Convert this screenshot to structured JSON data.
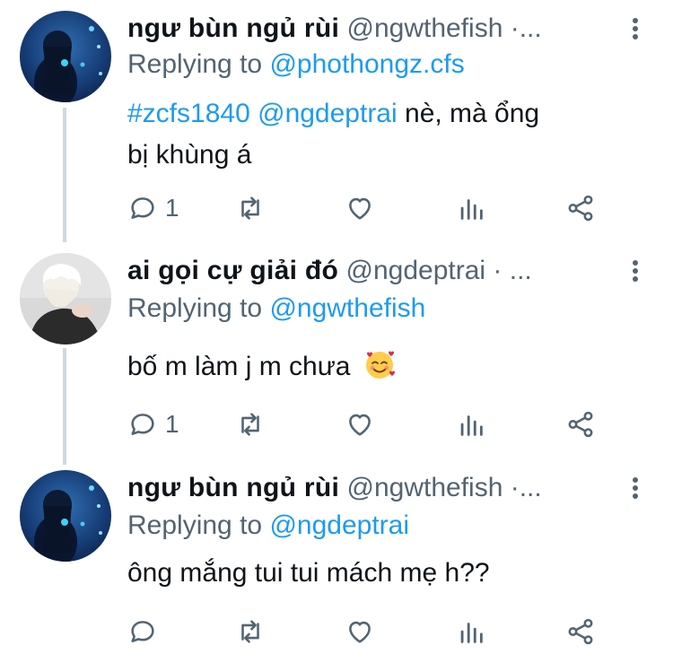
{
  "thread": {
    "tweets": [
      {
        "name": "ngư bùn ngủ rùi",
        "handle": "@ngwthefish ·...",
        "reply_prefix": "Replying to",
        "reply_to": "@phothongz.cfs",
        "text_hashtag": "#zcfs1840",
        "text_mention": "@ngdeptrai",
        "text_line1_rest": " nè, mà ổng",
        "text_line2": "bị khùng á",
        "reply_count": "1",
        "avatar_icon": "fish-aquarium-avatar"
      },
      {
        "name": "ai gọi cự giải đó",
        "handle": "@ngdeptrai · ...",
        "reply_prefix": "Replying to",
        "reply_to": "@ngwthefish",
        "text": "bố m làm j m chưa",
        "emoji_icon": "smiling-face-with-hearts-emoji",
        "reply_count": "1",
        "avatar_icon": "white-hair-person-avatar"
      },
      {
        "name": "ngư bùn ngủ rùi",
        "handle": "@ngwthefish ·...",
        "reply_prefix": "Replying to",
        "reply_to": "@ngdeptrai",
        "text": "ông mắng tui tui mách mẹ h??",
        "reply_count": "",
        "avatar_icon": "fish-aquarium-avatar"
      }
    ]
  },
  "colors": {
    "link": "#1d9bf0",
    "secondary_text": "#536471",
    "primary_text": "#0f1419",
    "thread_line": "#cfd9de"
  }
}
